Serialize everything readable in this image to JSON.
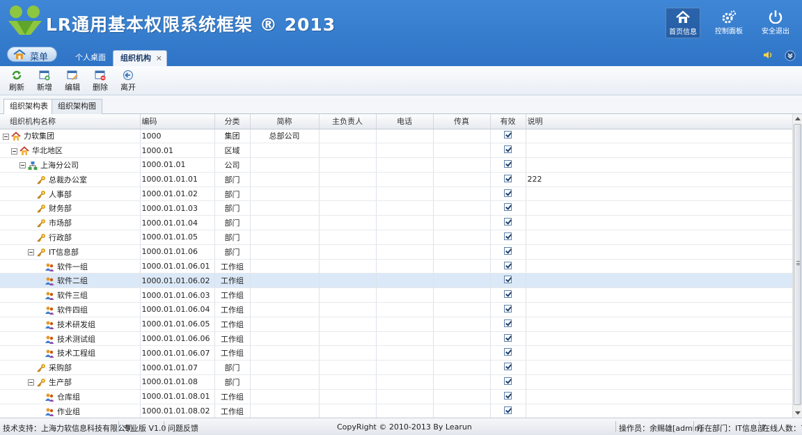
{
  "header": {
    "title": "LR通用基本权限系统框架 ® 2013",
    "buttons": [
      {
        "label": "首页信息",
        "icon": "home-icon",
        "active": true
      },
      {
        "label": "控制面板",
        "icon": "gear-icon",
        "active": false
      },
      {
        "label": "安全退出",
        "icon": "power-icon",
        "active": false
      }
    ]
  },
  "nav": {
    "menu_label": "菜单",
    "tabs": [
      {
        "label": "个人桌面"
      },
      {
        "label": "组织机构",
        "close": "×"
      }
    ]
  },
  "toolbar": {
    "refresh": "刷新",
    "add": "新增",
    "edit": "编辑",
    "delete": "删除",
    "leave": "离开"
  },
  "subtabs": [
    "组织架构表",
    "组织架构图"
  ],
  "grid": {
    "columns": [
      "组织机构名称",
      "编码",
      "分类",
      "简称",
      "主负责人",
      "电话",
      "传真",
      "有效",
      "说明"
    ],
    "rows": [
      {
        "name": "力软集团",
        "code": "1000",
        "type": "集团",
        "short": "总部公司",
        "note": "",
        "level": 0,
        "expand": true,
        "icon": "house"
      },
      {
        "name": "华北地区",
        "code": "1000.01",
        "type": "区域",
        "short": "",
        "note": "",
        "level": 1,
        "expand": true,
        "icon": "house"
      },
      {
        "name": "上海分公司",
        "code": "1000.01.01",
        "type": "公司",
        "short": "",
        "note": "",
        "level": 2,
        "expand": true,
        "icon": "org"
      },
      {
        "name": "总裁办公室",
        "code": "1000.01.01.01",
        "type": "部门",
        "short": "",
        "note": "222",
        "level": 3,
        "expand": false,
        "icon": "key"
      },
      {
        "name": "人事部",
        "code": "1000.01.01.02",
        "type": "部门",
        "short": "",
        "note": "",
        "level": 3,
        "expand": false,
        "icon": "key"
      },
      {
        "name": "财务部",
        "code": "1000.01.01.03",
        "type": "部门",
        "short": "",
        "note": "",
        "level": 3,
        "expand": false,
        "icon": "key"
      },
      {
        "name": "市场部",
        "code": "1000.01.01.04",
        "type": "部门",
        "short": "",
        "note": "",
        "level": 3,
        "expand": false,
        "icon": "key"
      },
      {
        "name": "行政部",
        "code": "1000.01.01.05",
        "type": "部门",
        "short": "",
        "note": "",
        "level": 3,
        "expand": false,
        "icon": "key"
      },
      {
        "name": "IT信息部",
        "code": "1000.01.01.06",
        "type": "部门",
        "short": "",
        "note": "",
        "level": 3,
        "expand": true,
        "icon": "key"
      },
      {
        "name": "软件一组",
        "code": "1000.01.01.06.01",
        "type": "工作组",
        "short": "",
        "note": "",
        "level": 4,
        "expand": false,
        "icon": "group"
      },
      {
        "name": "软件二组",
        "code": "1000.01.01.06.02",
        "type": "工作组",
        "short": "",
        "note": "",
        "level": 4,
        "expand": false,
        "icon": "group",
        "selected": true
      },
      {
        "name": "软件三组",
        "code": "1000.01.01.06.03",
        "type": "工作组",
        "short": "",
        "note": "",
        "level": 4,
        "expand": false,
        "icon": "group"
      },
      {
        "name": "软件四组",
        "code": "1000.01.01.06.04",
        "type": "工作组",
        "short": "",
        "note": "",
        "level": 4,
        "expand": false,
        "icon": "group"
      },
      {
        "name": "技术研发组",
        "code": "1000.01.01.06.05",
        "type": "工作组",
        "short": "",
        "note": "",
        "level": 4,
        "expand": false,
        "icon": "group"
      },
      {
        "name": "技术测试组",
        "code": "1000.01.01.06.06",
        "type": "工作组",
        "short": "",
        "note": "",
        "level": 4,
        "expand": false,
        "icon": "group"
      },
      {
        "name": "技术工程组",
        "code": "1000.01.01.06.07",
        "type": "工作组",
        "short": "",
        "note": "",
        "level": 4,
        "expand": false,
        "icon": "group"
      },
      {
        "name": "采购部",
        "code": "1000.01.01.07",
        "type": "部门",
        "short": "",
        "note": "",
        "level": 3,
        "expand": false,
        "icon": "key"
      },
      {
        "name": "生产部",
        "code": "1000.01.01.08",
        "type": "部门",
        "short": "",
        "note": "",
        "level": 3,
        "expand": true,
        "icon": "key"
      },
      {
        "name": "仓库组",
        "code": "1000.01.01.08.01",
        "type": "工作组",
        "short": "",
        "note": "",
        "level": 4,
        "expand": false,
        "icon": "group"
      },
      {
        "name": "作业组",
        "code": "1000.01.01.08.02",
        "type": "工作组",
        "short": "",
        "note": "",
        "level": 4,
        "expand": false,
        "icon": "group"
      }
    ]
  },
  "footer": {
    "support": "技术支持：上海力软信息科技有限公司",
    "edition": "专业版 V1.0",
    "feedback": "问题反馈",
    "copyright": "CopyRight © 2010-2013 By Learun",
    "operator": "操作员：余赐雄[admin]",
    "department": "所在部门：IT信息部",
    "online": "在线人数：7"
  }
}
